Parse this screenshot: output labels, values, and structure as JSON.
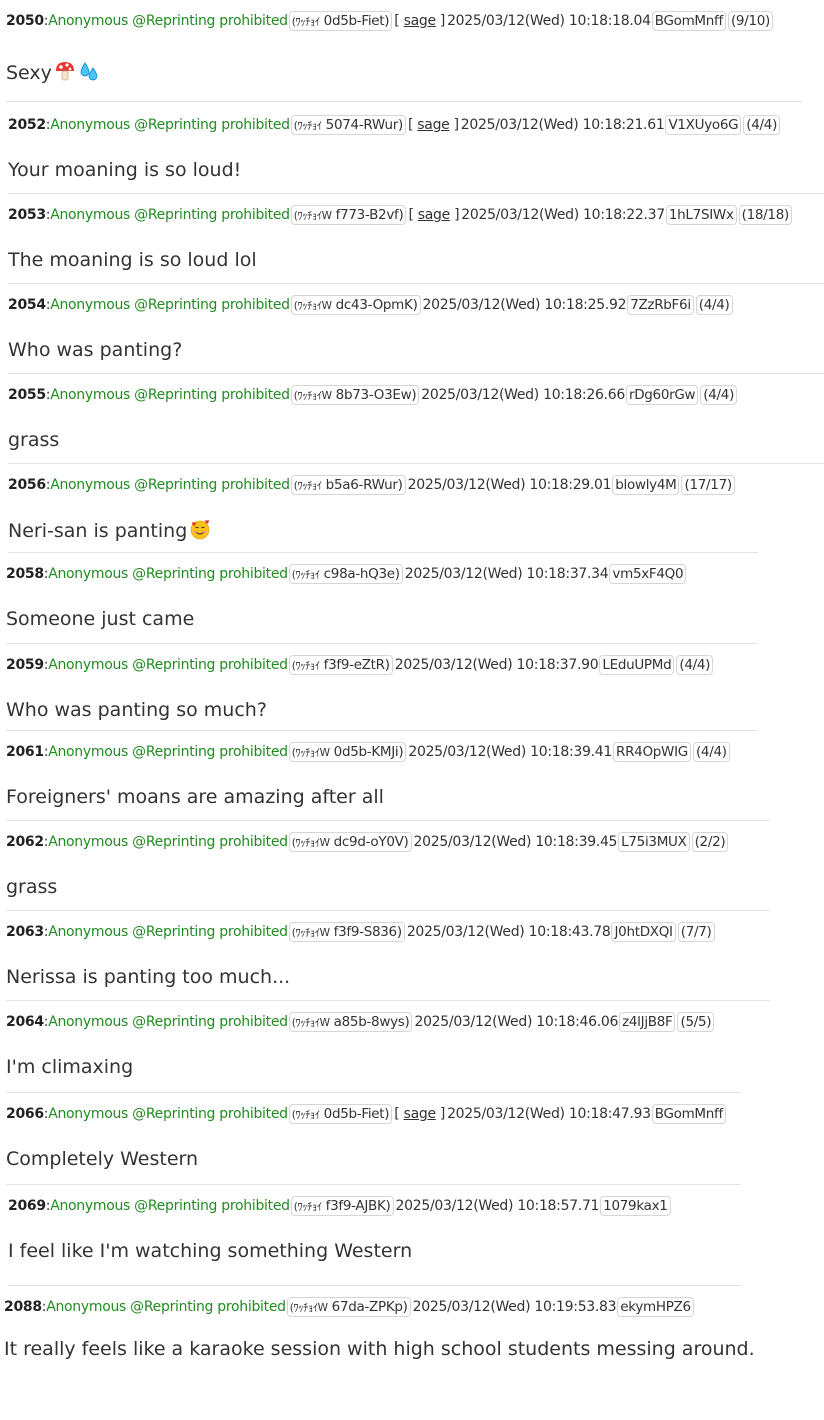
{
  "posts": [
    {
      "number": "2050",
      "name": "Anonymous @Reprinting prohibited",
      "kana": "(ﾜｯﾁｮｲ",
      "tag": "0d5b-Fiet)",
      "sage": true,
      "timestamp": "2025/03/12(Wed) 10:18:18.04",
      "id": "BGomMnff",
      "count": "(9/10)",
      "body": "Sexy",
      "emojis": [
        "mushroom-icon",
        "sweat-droplets-icon"
      ]
    },
    {
      "number": "2052",
      "name": "Anonymous @Reprinting prohibited",
      "kana": "(ﾜｯﾁｮｲ",
      "tag": "5074-RWur)",
      "sage": true,
      "timestamp": "2025/03/12(Wed) 10:18:21.61",
      "id": "V1XUyo6G",
      "count": "(4/4)",
      "body": "Your moaning is so loud!",
      "emojis": []
    },
    {
      "number": "2053",
      "name": "Anonymous @Reprinting prohibited",
      "kana": "(ﾜｯﾁｮｲW",
      "tag": "f773-B2vf)",
      "sage": true,
      "timestamp": "2025/03/12(Wed) 10:18:22.37",
      "id": "1hL7SIWx",
      "count": "(18/18)",
      "body": "The moaning is so loud lol",
      "emojis": []
    },
    {
      "number": "2054",
      "name": "Anonymous @Reprinting prohibited",
      "kana": "(ﾜｯﾁｮｲW",
      "tag": "dc43-OpmK)",
      "sage": false,
      "timestamp": "2025/03/12(Wed) 10:18:25.92",
      "id": "7ZzRbF6i",
      "count": "(4/4)",
      "body": "Who was panting?",
      "emojis": []
    },
    {
      "number": "2055",
      "name": "Anonymous @Reprinting prohibited",
      "kana": "(ﾜｯﾁｮｲW",
      "tag": "8b73-O3Ew)",
      "sage": false,
      "timestamp": "2025/03/12(Wed) 10:18:26.66",
      "id": "rDg60rGw",
      "count": "(4/4)",
      "body": "grass",
      "emojis": []
    },
    {
      "number": "2056",
      "name": "Anonymous @Reprinting prohibited",
      "kana": "(ﾜｯﾁｮｲ",
      "tag": "b5a6-RWur)",
      "sage": false,
      "timestamp": "2025/03/12(Wed) 10:18:29.01",
      "id": "blowly4M",
      "count": "(17/17)",
      "body": "Neri-san is panting",
      "emojis": [
        "smiling-face-with-hearts-icon"
      ]
    },
    {
      "number": "2058",
      "name": "Anonymous @Reprinting prohibited",
      "kana": "(ﾜｯﾁｮｲ",
      "tag": "c98a-hQ3e)",
      "sage": false,
      "timestamp": "2025/03/12(Wed) 10:18:37.34",
      "id": "vm5xF4Q0",
      "count": "",
      "body": "Someone just came",
      "emojis": []
    },
    {
      "number": "2059",
      "name": "Anonymous @Reprinting prohibited",
      "kana": "(ﾜｯﾁｮｲ",
      "tag": "f3f9-eZtR)",
      "sage": false,
      "timestamp": "2025/03/12(Wed) 10:18:37.90",
      "id": "LEduUPMd",
      "count": "(4/4)",
      "body": "Who was panting so much?",
      "emojis": []
    },
    {
      "number": "2061",
      "name": "Anonymous @Reprinting prohibited",
      "kana": "(ﾜｯﾁｮｲW",
      "tag": "0d5b-KMJi)",
      "sage": false,
      "timestamp": "2025/03/12(Wed) 10:18:39.41",
      "id": "RR4OpWIG",
      "count": "(4/4)",
      "body": "Foreigners' moans are amazing after all",
      "emojis": []
    },
    {
      "number": "2062",
      "name": "Anonymous @Reprinting prohibited",
      "kana": "(ﾜｯﾁｮｲW",
      "tag": "dc9d-oY0V)",
      "sage": false,
      "timestamp": "2025/03/12(Wed) 10:18:39.45",
      "id": "L75i3MUX",
      "count": "(2/2)",
      "body": "grass",
      "emojis": []
    },
    {
      "number": "2063",
      "name": "Anonymous @Reprinting prohibited",
      "kana": "(ﾜｯﾁｮｲW",
      "tag": "f3f9-S836)",
      "sage": false,
      "timestamp": "2025/03/12(Wed) 10:18:43.78",
      "id": "J0htDXQI",
      "count": "(7/7)",
      "body": "Nerissa is panting too much...",
      "emojis": []
    },
    {
      "number": "2064",
      "name": "Anonymous @Reprinting prohibited",
      "kana": "(ﾜｯﾁｮｲW",
      "tag": "a85b-8wys)",
      "sage": false,
      "timestamp": "2025/03/12(Wed) 10:18:46.06",
      "id": "z4lJjB8F",
      "count": "(5/5)",
      "body": "I'm climaxing",
      "emojis": []
    },
    {
      "number": "2066",
      "name": "Anonymous @Reprinting prohibited",
      "kana": "(ﾜｯﾁｮｲ",
      "tag": "0d5b-Fiet)",
      "sage": true,
      "timestamp": "2025/03/12(Wed) 10:18:47.93",
      "id": "BGomMnff",
      "count": "",
      "body": "Completely Western",
      "emojis": []
    },
    {
      "number": "2069",
      "name": "Anonymous @Reprinting prohibited",
      "kana": "(ﾜｯﾁｮｲ",
      "tag": "f3f9-AJBK)",
      "sage": false,
      "timestamp": "2025/03/12(Wed) 10:18:57.71",
      "id": "1079kax1",
      "count": "",
      "body": "I feel like I'm watching something Western",
      "emojis": []
    },
    {
      "number": "2088",
      "name": "Anonymous @Reprinting prohibited",
      "kana": "(ﾜｯﾁｮｲW",
      "tag": "67da-ZPKp)",
      "sage": false,
      "timestamp": "2025/03/12(Wed) 10:19:53.83",
      "id": "ekymHPZ6",
      "count": "",
      "body": "It really feels like a karaoke session with high school students messing around.",
      "emojis": []
    }
  ],
  "sage_label": "sage",
  "colors": {
    "name": "#228b22",
    "text": "#333333",
    "border": "#d6d6d6",
    "divider": "#e3e3e3"
  }
}
